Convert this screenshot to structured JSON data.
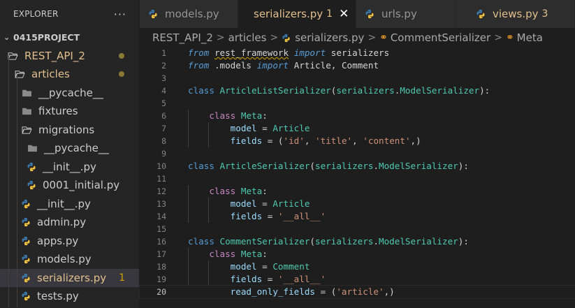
{
  "sidebar": {
    "title": "EXPLORER",
    "more_icon": "ellipsis-icon",
    "project": "0415PROJECT",
    "items": [
      {
        "label": "REST_API_2",
        "type": "folder-open",
        "indent": 0,
        "color": "yellow",
        "badge": "dot"
      },
      {
        "label": "articles",
        "type": "folder-open",
        "indent": 1,
        "color": "yellow",
        "badge": "dot"
      },
      {
        "label": "__pycache__",
        "type": "folder",
        "indent": 2
      },
      {
        "label": "fixtures",
        "type": "folder",
        "indent": 2
      },
      {
        "label": "migrations",
        "type": "folder-open",
        "indent": 2
      },
      {
        "label": "__pycache__",
        "type": "folder",
        "indent": 3
      },
      {
        "label": "__init__.py",
        "type": "py",
        "indent": 3
      },
      {
        "label": "0001_initial.py",
        "type": "py",
        "indent": 3
      },
      {
        "label": "__init__.py",
        "type": "py",
        "indent": 2
      },
      {
        "label": "admin.py",
        "type": "py",
        "indent": 2
      },
      {
        "label": "apps.py",
        "type": "py",
        "indent": 2
      },
      {
        "label": "models.py",
        "type": "py",
        "indent": 2
      },
      {
        "label": "serializers.py",
        "type": "py",
        "indent": 2,
        "color": "yellow",
        "badge": "1",
        "selected": true
      },
      {
        "label": "tests.py",
        "type": "py",
        "indent": 2
      }
    ]
  },
  "tabs": [
    {
      "label": "models.py",
      "active": false
    },
    {
      "label": "serializers.py",
      "badge": "1",
      "active": true,
      "close_icon": "close-icon"
    },
    {
      "label": "urls.py",
      "active": false
    },
    {
      "label": "views.py",
      "badge": "3",
      "active": false,
      "warn": true
    }
  ],
  "breadcrumb": {
    "parts": [
      "REST_API_2",
      "articles",
      "serializers.py",
      "CommentSerializer",
      "Meta"
    ]
  },
  "editor": {
    "line_numbers": [
      "1",
      "2",
      "3",
      "4",
      "5",
      "6",
      "7",
      "8",
      "9",
      "10",
      "11",
      "12",
      "13",
      "14",
      "15",
      "16",
      "17",
      "18",
      "19",
      "20"
    ],
    "current_line": 20,
    "tokens": {
      "from": "from",
      "import": "import",
      "class": "class",
      "rest_framework": "rest_framework",
      "serializers": "serializers",
      "models": ".models",
      "Article": "Article",
      "Comment": "Comment",
      "comma": ", ",
      "ArticleListSerializer": "ArticleListSerializer",
      "ArticleSerializer": "ArticleSerializer",
      "CommentSerializer": "CommentSerializer",
      "ModelSerializer": "ModelSerializer",
      "Meta": "Meta",
      "model": "model",
      "fields": "fields",
      "read_only_fields": "read_only_fields",
      "eq": " = ",
      "str_id": "'id'",
      "str_title": "'title'",
      "str_content": "'content'",
      "str_all": "'__all__'",
      "str_article": "'article'"
    }
  }
}
